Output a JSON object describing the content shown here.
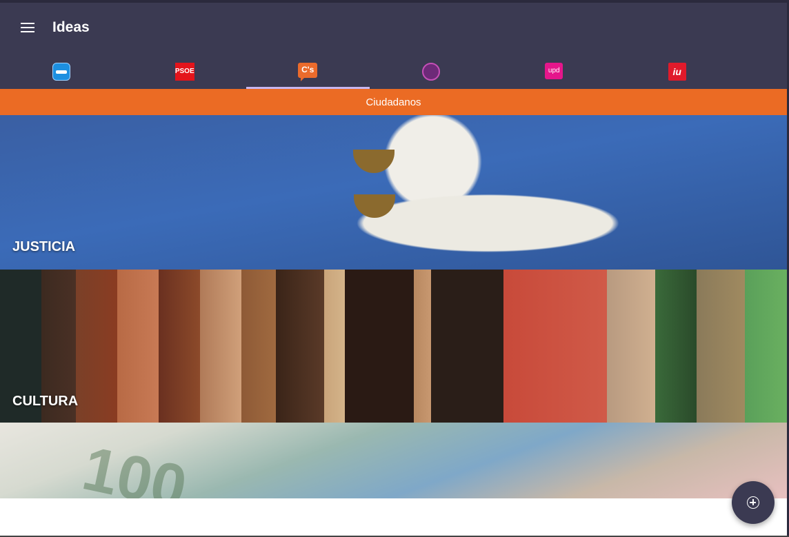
{
  "app_bar": {
    "title": "Ideas",
    "menu_icon": "hamburger-menu-icon"
  },
  "tabs": [
    {
      "id": "pp",
      "logo_text": "PP",
      "color": "#1d8fe0"
    },
    {
      "id": "psoe",
      "logo_text": "PSOE",
      "color": "#e4141b"
    },
    {
      "id": "ciudadanos",
      "logo_text": "C's",
      "color": "#eb6b2c",
      "selected": true
    },
    {
      "id": "podemos",
      "logo_text": "",
      "color": "#6d2a78"
    },
    {
      "id": "upyd",
      "logo_text": "upd",
      "color": "#e5168b"
    },
    {
      "id": "iu",
      "logo_text": "iu",
      "color": "#e01a2b"
    }
  ],
  "party_banner": {
    "label": "Ciudadanos",
    "color": "#eb6b24"
  },
  "categories": [
    {
      "label": "JUSTICIA"
    },
    {
      "label": "CULTURA"
    },
    {
      "label": ""
    }
  ],
  "fab": {
    "icon": "add-circle-icon"
  },
  "colors": {
    "primary": "#3b3a52",
    "accent_indicator": "#c9b6f0"
  }
}
